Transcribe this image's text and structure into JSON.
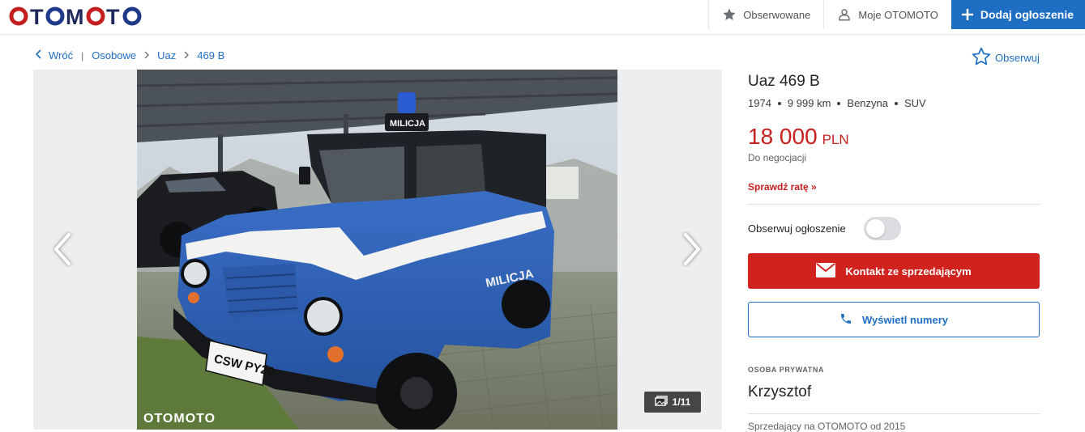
{
  "header": {
    "logo": "OTOMOTO",
    "nav": [
      {
        "label": "Obserwowane",
        "icon": "star-icon"
      },
      {
        "label": "Moje OTOMOTO",
        "icon": "user-icon"
      },
      {
        "label": "Dodaj ogłoszenie",
        "icon": "plus-icon"
      }
    ]
  },
  "breadcrumb": {
    "back": "Wróć",
    "items": [
      "Osobowe",
      "Uaz",
      "469 B"
    ]
  },
  "follow_label": "Obserwuj",
  "gallery": {
    "counter": "1/11",
    "watermark": "OTOMOTO",
    "plate": "CSW PY20",
    "sign": "MILICJA",
    "door_text": "MILICJA"
  },
  "listing": {
    "title": "Uaz 469 B",
    "params": [
      "1974",
      "9 999 km",
      "Benzyna",
      "SUV"
    ],
    "price": "18 000",
    "currency": "PLN",
    "negotiable": "Do negocjacji",
    "rate_link": "Sprawdź ratę »",
    "watch_label": "Obserwuj ogłoszenie",
    "contact_button": "Kontakt ze sprzedającym",
    "phone_button": "Wyświetl numery",
    "seller_type": "OSOBA PRYWATNA",
    "seller_name": "Krzysztof",
    "seller_since": "Sprzedający na OTOMOTO od 2015"
  },
  "colors": {
    "brand_red": "#c5211f",
    "brand_blue": "#1e6fc4"
  }
}
